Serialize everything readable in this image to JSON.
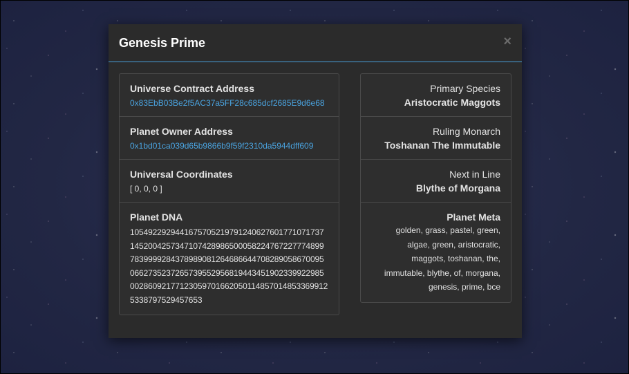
{
  "modal": {
    "title": "Genesis Prime",
    "close_label": "×"
  },
  "left_panel": {
    "universe_contract": {
      "label": "Universe Contract Address",
      "value": "0x83EbB03Be2f5AC37a5FF28c685dcf2685E9d6e68"
    },
    "planet_owner": {
      "label": "Planet Owner Address",
      "value": "0x1bd01ca039d65b9866b9f59f2310da5944dff609"
    },
    "coordinates": {
      "label": "Universal Coordinates",
      "value": "[ 0, 0, 0 ]"
    },
    "dna": {
      "label": "Planet DNA",
      "value": "1054922929441675705219791240627601771071737145200425734710742898650005822476722777489978399992843789890812646866447082890586700950662735237265739552956819443451902339922985002860921771230597016620501148570148533699125338797529457653"
    }
  },
  "right_panel": {
    "species": {
      "label": "Primary Species",
      "value": "Aristocratic Maggots"
    },
    "monarch": {
      "label": "Ruling Monarch",
      "value": "Toshanan The Immutable"
    },
    "next_in_line": {
      "label": "Next in Line",
      "value": "Blythe of Morgana"
    },
    "meta": {
      "label": "Planet Meta",
      "value": "golden, grass, pastel, green, algae, green, aristocratic, maggots, toshanan, the, immutable, blythe, of, morgana, genesis, prime, bce"
    }
  },
  "colors": {
    "accent": "#4aa3df",
    "modal_bg": "#2b2b2b",
    "panel_bg": "#2e2e2e",
    "text": "#e3e3e3"
  },
  "icons": {
    "close": "close-icon"
  }
}
